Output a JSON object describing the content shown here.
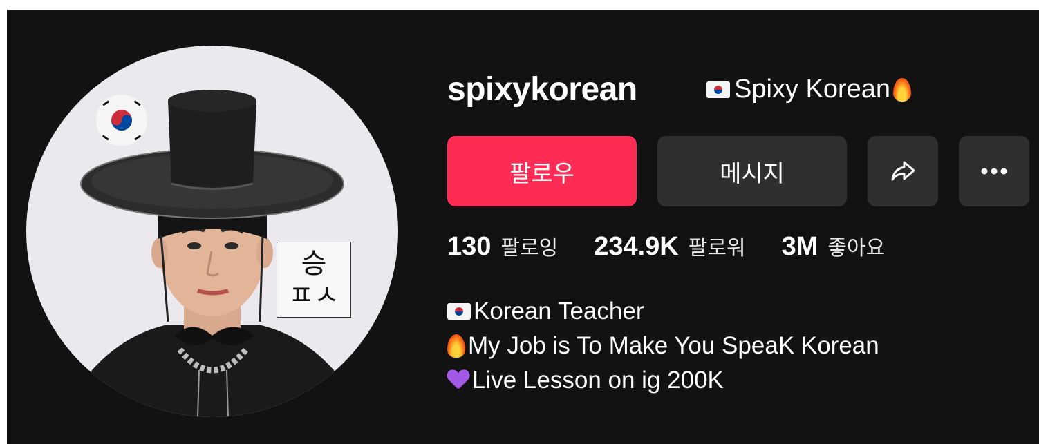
{
  "profile": {
    "username": "spixykorean",
    "nickname": "Spixy Korean",
    "avatar_text_top": "승",
    "avatar_text_bottom": "ㅍㅅ"
  },
  "actions": {
    "follow_label": "팔로우",
    "message_label": "메시지",
    "share_icon": "share-arrow-icon",
    "more_icon": "more-dots-icon"
  },
  "stats": {
    "following": {
      "value": "130",
      "label": "팔로잉"
    },
    "followers": {
      "value": "234.9K",
      "label": "팔로워"
    },
    "likes": {
      "value": "3M",
      "label": "좋아요"
    }
  },
  "bio": {
    "line1": "Korean Teacher",
    "line2": "My Job is To Make You SpeaK Korean",
    "line3": "Live Lesson on ig 200K"
  },
  "colors": {
    "background": "#121212",
    "follow_button": "#fe2c55",
    "secondary_button": "#2f2f2f",
    "text": "#ffffff"
  }
}
